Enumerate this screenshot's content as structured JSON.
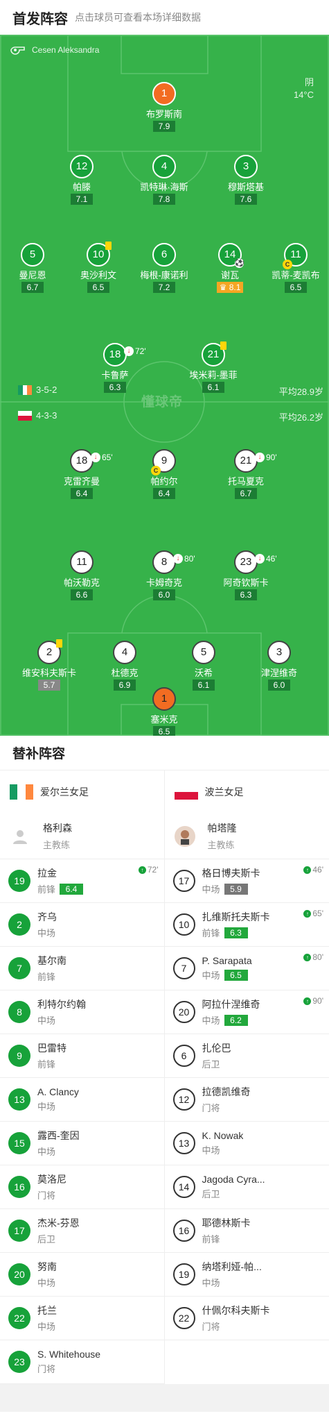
{
  "header": {
    "title": "首发阵容",
    "subtitle": "点击球员可查看本场详细数据"
  },
  "match": {
    "referee": "Cesen Aleksandra",
    "weather": "阴",
    "temperature": "14°C",
    "watermark": "懂球帝"
  },
  "home_team": {
    "formation": "3-5-2",
    "avg_age": "平均28.9岁",
    "flag_colors": [
      "#169b62",
      "#ffffff",
      "#ff883e"
    ]
  },
  "away_team": {
    "formation": "4-3-3",
    "avg_age": "平均26.2岁",
    "flag_colors": [
      "#ffffff",
      "#dc143c"
    ]
  },
  "home_lineup": [
    {
      "num": "1",
      "name": "布罗斯南",
      "rating": "7.9",
      "gk": true
    },
    {
      "num": "12",
      "name": "帕滕",
      "rating": "7.1"
    },
    {
      "num": "4",
      "name": "凯特琳·海斯",
      "rating": "7.8"
    },
    {
      "num": "3",
      "name": "穆斯塔基",
      "rating": "7.6"
    },
    {
      "num": "5",
      "name": "曼尼恩",
      "rating": "6.7"
    },
    {
      "num": "10",
      "name": "奥沙利文",
      "rating": "6.5",
      "yellow": true
    },
    {
      "num": "6",
      "name": "梅根-康诺利",
      "rating": "7.2"
    },
    {
      "num": "14",
      "name": "谢瓦",
      "rating": "8.1",
      "best": true,
      "goal": true
    },
    {
      "num": "11",
      "name": "凯蒂-麦凯布",
      "rating": "6.5",
      "captain": true
    },
    {
      "num": "18",
      "name": "卡鲁萨",
      "rating": "6.3",
      "sub_min": "72'"
    },
    {
      "num": "21",
      "name": "埃米莉-墨菲",
      "rating": "6.1",
      "yellow": true
    }
  ],
  "away_lineup": [
    {
      "num": "18",
      "name": "克雷齐曼",
      "rating": "6.4",
      "sub_min": "65'"
    },
    {
      "num": "9",
      "name": "帕约尔",
      "rating": "6.4",
      "captain": true
    },
    {
      "num": "21",
      "name": "托马夏克",
      "rating": "6.7",
      "sub_min": "90'"
    },
    {
      "num": "11",
      "name": "帕沃勒克",
      "rating": "6.6"
    },
    {
      "num": "8",
      "name": "卡姆奇克",
      "rating": "6.0",
      "sub_min": "80'"
    },
    {
      "num": "23",
      "name": "阿奇钦斯卡",
      "rating": "6.3",
      "sub_min": "46'"
    },
    {
      "num": "2",
      "name": "维安科夫斯卡",
      "rating": "5.7",
      "yellow": true,
      "grey": true
    },
    {
      "num": "4",
      "name": "杜德克",
      "rating": "6.9"
    },
    {
      "num": "5",
      "name": "沃希",
      "rating": "6.1"
    },
    {
      "num": "3",
      "name": "津涅维奇",
      "rating": "6.0"
    },
    {
      "num": "1",
      "name": "塞米克",
      "rating": "6.5",
      "gk": true
    }
  ],
  "bench": {
    "title": "替补阵容",
    "home": {
      "team": "爱尔兰女足",
      "coach": {
        "name": "格利森",
        "role": "主教练"
      },
      "players": [
        {
          "num": "19",
          "name": "拉金",
          "pos": "前锋",
          "rating": "6.4",
          "in": "72'"
        },
        {
          "num": "2",
          "name": "齐乌",
          "pos": "中场"
        },
        {
          "num": "7",
          "name": "基尔南",
          "pos": "前锋"
        },
        {
          "num": "8",
          "name": "利特尔约翰",
          "pos": "中场"
        },
        {
          "num": "9",
          "name": "巴雷特",
          "pos": "前锋"
        },
        {
          "num": "13",
          "name": "A. Clancy",
          "pos": "中场"
        },
        {
          "num": "15",
          "name": "露西-奎因",
          "pos": "中场"
        },
        {
          "num": "16",
          "name": "莫洛尼",
          "pos": "门将"
        },
        {
          "num": "17",
          "name": "杰米-芬恩",
          "pos": "后卫"
        },
        {
          "num": "20",
          "name": "努南",
          "pos": "中场"
        },
        {
          "num": "22",
          "name": "托兰",
          "pos": "中场"
        },
        {
          "num": "23",
          "name": "S. Whitehouse",
          "pos": "门将"
        }
      ]
    },
    "away": {
      "team": "波兰女足",
      "coach": {
        "name": "帕塔隆",
        "role": "主教练"
      },
      "players": [
        {
          "num": "17",
          "name": "格日博夫斯卡",
          "pos": "中场",
          "rating": "5.9",
          "grey": true,
          "in": "46'"
        },
        {
          "num": "10",
          "name": "扎维斯托夫斯卡",
          "pos": "前锋",
          "rating": "6.3",
          "in": "65'"
        },
        {
          "num": "7",
          "name": "P. Sarapata",
          "pos": "中场",
          "rating": "6.5",
          "in": "80'"
        },
        {
          "num": "20",
          "name": "阿拉什涅维奇",
          "pos": "中场",
          "rating": "6.2",
          "in": "90'"
        },
        {
          "num": "6",
          "name": "扎伦巴",
          "pos": "后卫"
        },
        {
          "num": "12",
          "name": "拉德凯维奇",
          "pos": "门将"
        },
        {
          "num": "13",
          "name": "K. Nowak",
          "pos": "中场"
        },
        {
          "num": "14",
          "name": "Jagoda Cyra...",
          "pos": "后卫"
        },
        {
          "num": "16",
          "name": "耶德林斯卡",
          "pos": "前锋"
        },
        {
          "num": "19",
          "name": "纳塔利娅-帕...",
          "pos": "中场"
        },
        {
          "num": "22",
          "name": "什佩尔科夫斯卡",
          "pos": "门将"
        }
      ]
    }
  }
}
